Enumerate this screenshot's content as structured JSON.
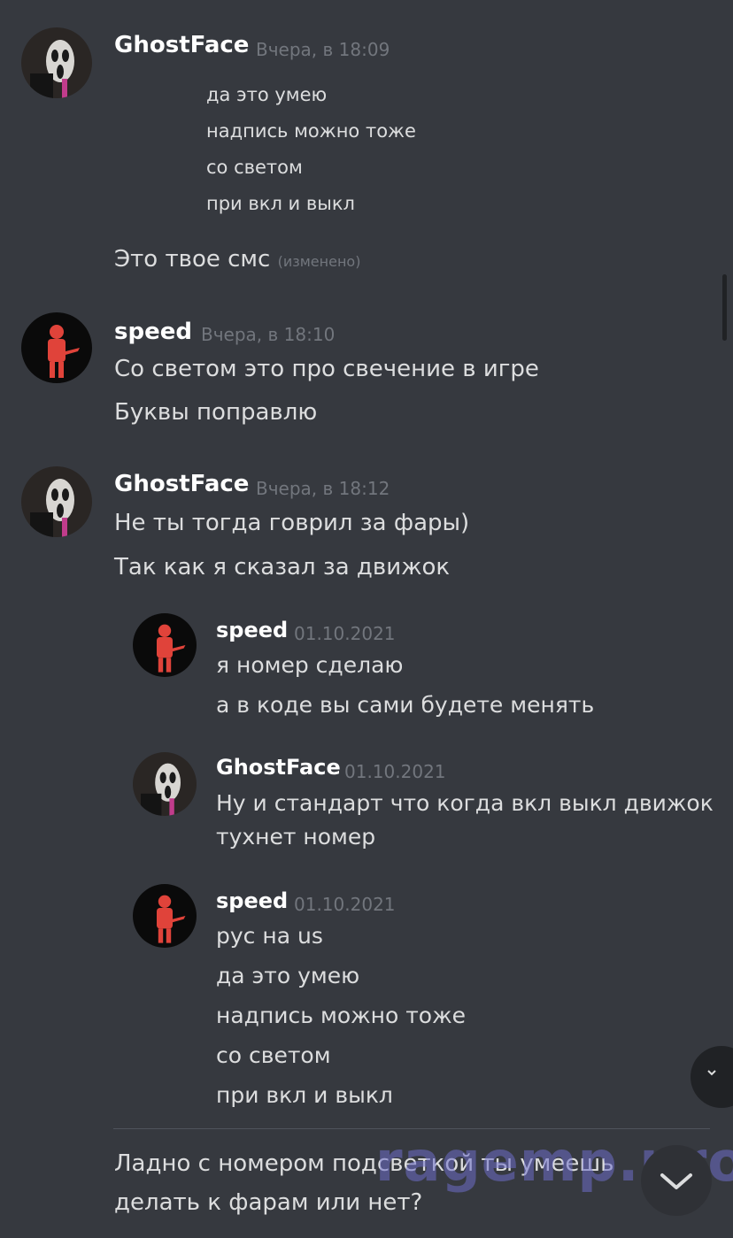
{
  "messages": {
    "m1": {
      "author": "GhostFace",
      "time": "Вчера, в 18:09",
      "lines": [
        "да это умею",
        "надпись можно тоже",
        "со светом",
        "при вкл и выкл"
      ],
      "followup": "Это твое  смс",
      "edited": "(изменено)"
    },
    "m2": {
      "author": "speed",
      "time": "Вчера, в 18:10",
      "lines": [
        "Со светом это про свечение в игре",
        "Буквы поправлю"
      ]
    },
    "m3": {
      "author": "GhostFace",
      "time": "Вчера, в 18:12",
      "lines": [
        "Не ты тогда говрил за фары)",
        "Так как я сказал за движок"
      ]
    },
    "q1": {
      "author": "speed",
      "time": "01.10.2021",
      "lines": [
        "я номер сделаю",
        "а в коде вы сами будете менять"
      ]
    },
    "q2": {
      "author": "GhostFace",
      "time": "01.10.2021",
      "lines": [
        "Ну и стандарт что когда вкл выкл движок",
        "тухнет номер"
      ]
    },
    "q3": {
      "author": "speed",
      "time": "01.10.2021",
      "lines": [
        "рус на us",
        "да это умею",
        "надпись можно тоже",
        "со светом",
        "при вкл и выкл"
      ]
    },
    "last": {
      "lines": [
        "Ладно с номером подсветкой ты умеешь",
        "делать к фарам или нет?"
      ]
    }
  },
  "watermark": "ragemp.pro",
  "icons": {
    "jump": "chevron-down-icon"
  },
  "colors": {
    "background": "#36393f",
    "author": "#ffffff",
    "text": "#dcddde",
    "muted": "#72767d",
    "speed_avatar_figure": "#e0433a"
  }
}
